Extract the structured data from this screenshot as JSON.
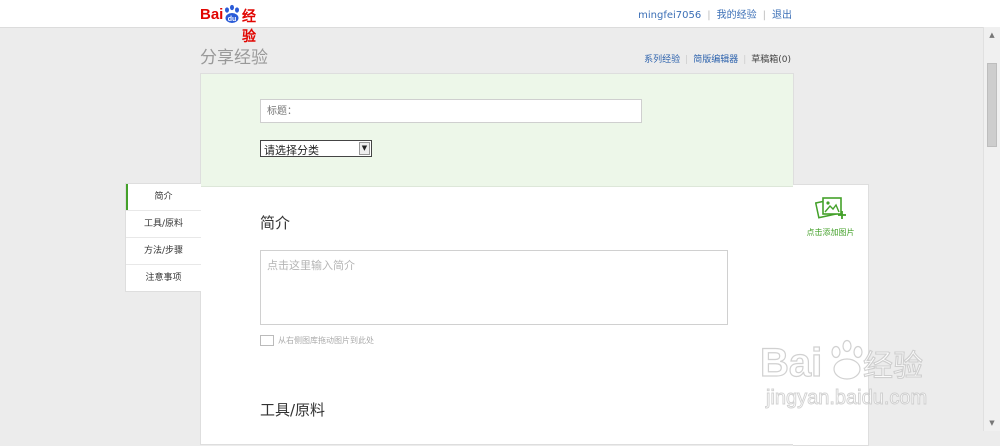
{
  "header": {
    "logo_text": "Bai du 经验",
    "user": {
      "username": "mingfei7056",
      "my_experience": "我的经验",
      "logout": "退出"
    }
  },
  "page": {
    "title": "分享经验",
    "subnav": {
      "series": "系列经验",
      "simple_editor": "简版编辑器",
      "drafts": "草稿箱(0)"
    }
  },
  "form": {
    "title_placeholder": "标题：",
    "category_selected": "请选择分类"
  },
  "tabs": [
    {
      "label": "简介"
    },
    {
      "label": "工具/原料"
    },
    {
      "label": "方法/步骤"
    },
    {
      "label": "注意事项"
    }
  ],
  "sections": {
    "intro_heading": "简介",
    "intro_placeholder": "点击这里输入简介",
    "drag_hint": "从右侧图库拖动图片到此处",
    "tools_heading": "工具/原料"
  },
  "right_panel": {
    "add_image_label": "点击添加图片",
    "icon": "add-image-icon"
  },
  "watermark": {
    "line1": "Baidu 经验",
    "line2": "jingyan.baidu.com"
  },
  "colors": {
    "brand_red": "#e10602",
    "link_blue": "#2e63ad",
    "accent_green": "#44a12a",
    "green_bg": "#edf7e9"
  }
}
